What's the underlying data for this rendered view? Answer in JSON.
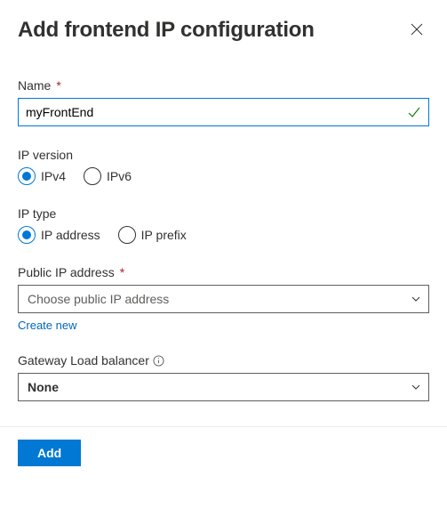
{
  "panel": {
    "title": "Add frontend IP configuration"
  },
  "name": {
    "label": "Name",
    "value": "myFrontEnd"
  },
  "ipVersion": {
    "label": "IP version",
    "options": {
      "v4": "IPv4",
      "v6": "IPv6"
    },
    "selected": "v4"
  },
  "ipType": {
    "label": "IP type",
    "options": {
      "addr": "IP address",
      "prefix": "IP prefix"
    },
    "selected": "addr"
  },
  "publicIp": {
    "label": "Public IP address",
    "placeholder": "Choose public IP address",
    "createNew": "Create new"
  },
  "gateway": {
    "label": "Gateway Load balancer",
    "value": "None"
  },
  "footer": {
    "addBtn": "Add"
  }
}
